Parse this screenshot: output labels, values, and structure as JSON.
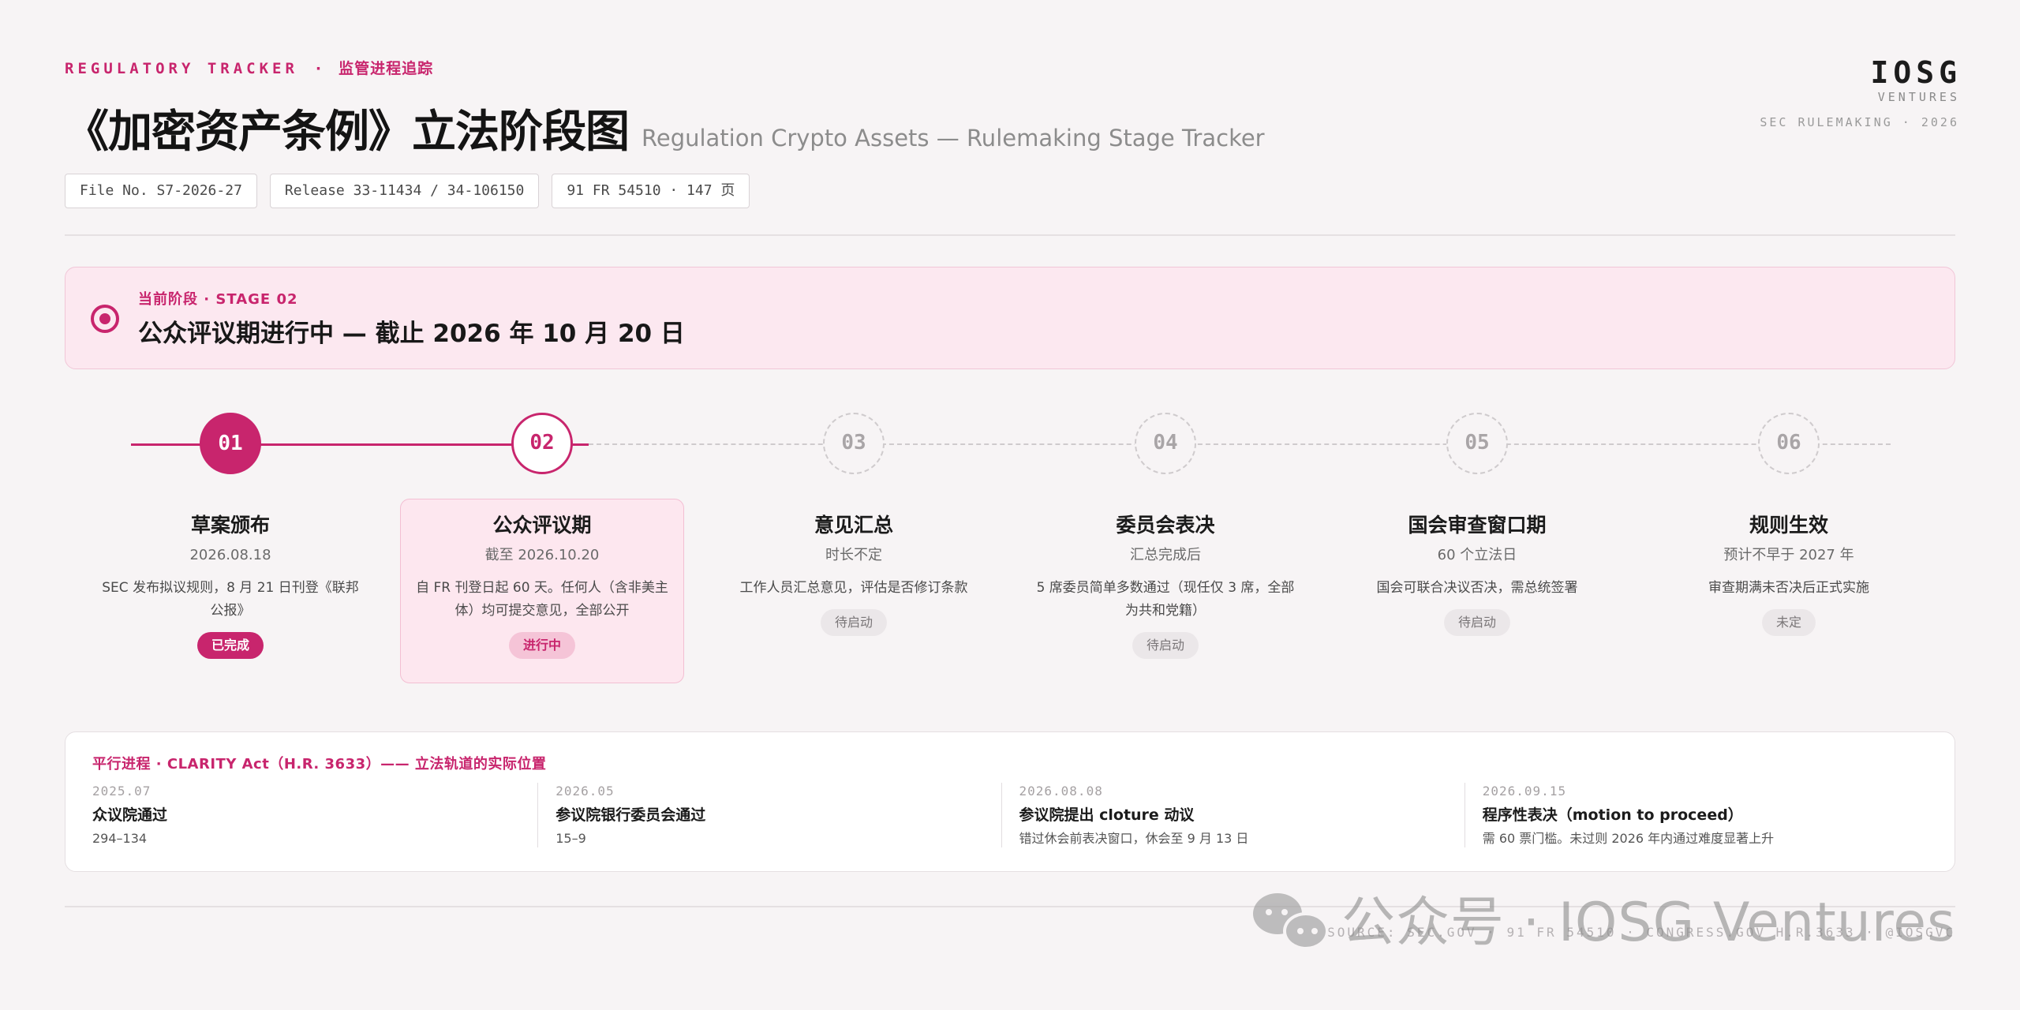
{
  "header": {
    "kicker_en": "REGULATORY TRACKER",
    "kicker_dot": "·",
    "kicker_cn": "监管进程追踪",
    "title_cn": "《加密资产条例》立法阶段图",
    "title_en": "Regulation Crypto Assets — Rulemaking Stage Tracker",
    "chips": [
      "File No. S7-2026-27",
      "Release 33-11434 / 34-106150",
      "91 FR 54510 · 147 页"
    ]
  },
  "brand": {
    "name": "IOSG",
    "sub": "VENTURES",
    "meta": "SEC RULEMAKING · 2026"
  },
  "banner": {
    "label": "当前阶段 · STAGE 02",
    "title": "公众评议期进行中 — 截止 2026 年 10 月 20 日",
    "icon": "target-icon"
  },
  "stages": [
    {
      "num": "01",
      "name": "草案颁布",
      "date": "2026.08.18",
      "desc": "SEC 发布拟议规则，8 月 21 日刊登《联邦公报》",
      "badge": "已完成",
      "status": "done"
    },
    {
      "num": "02",
      "name": "公众评议期",
      "date": "截至 2026.10.20",
      "desc": "自 FR 刊登日起 60 天。任何人（含非美主体）均可提交意见，全部公开",
      "badge": "进行中",
      "status": "current"
    },
    {
      "num": "03",
      "name": "意见汇总",
      "date": "时长不定",
      "desc": "工作人员汇总意见，评估是否修订条款",
      "badge": "待启动",
      "status": "todo"
    },
    {
      "num": "04",
      "name": "委员会表决",
      "date": "汇总完成后",
      "desc": "5 席委员简单多数通过（现任仅 3 席，全部为共和党籍）",
      "badge": "待启动",
      "status": "todo"
    },
    {
      "num": "05",
      "name": "国会审查窗口期",
      "date": "60 个立法日",
      "desc": "国会可联合决议否决，需总统签署",
      "badge": "待启动",
      "status": "todo"
    },
    {
      "num": "06",
      "name": "规则生效",
      "date": "预计不早于 2027 年",
      "desc": "审查期满未否决后正式实施",
      "badge": "未定",
      "status": "todo"
    }
  ],
  "parallel": {
    "title": "平行进程 · CLARITY Act（H.R. 3633）—— 立法轨道的实际位置",
    "items": [
      {
        "date": "2025.07",
        "name": "众议院通过",
        "note": "294–134"
      },
      {
        "date": "2026.05",
        "name": "参议院银行委员会通过",
        "note": "15–9"
      },
      {
        "date": "2026.08.08",
        "name": "参议院提出 cloture 动议",
        "note": "错过休会前表决窗口，休会至 9 月 13 日"
      },
      {
        "date": "2026.09.15",
        "name": "程序性表决（motion to proceed）",
        "note": "需 60 票门槛。未过则 2026 年内通过难度显著上升"
      }
    ]
  },
  "footer": {
    "source": "SOURCE: SEC.GOV · 91 FR 54510 · CONGRESS.GOV H.R.3633 · @IOSGVC",
    "watermark": "公众号 · IOSG Ventures",
    "watermark_icon": "wechat-icon"
  },
  "colors": {
    "accent": "#c8256d",
    "accent_soft": "#fce8f0",
    "background": "#f7f4f5",
    "muted": "#cfcbcd"
  }
}
